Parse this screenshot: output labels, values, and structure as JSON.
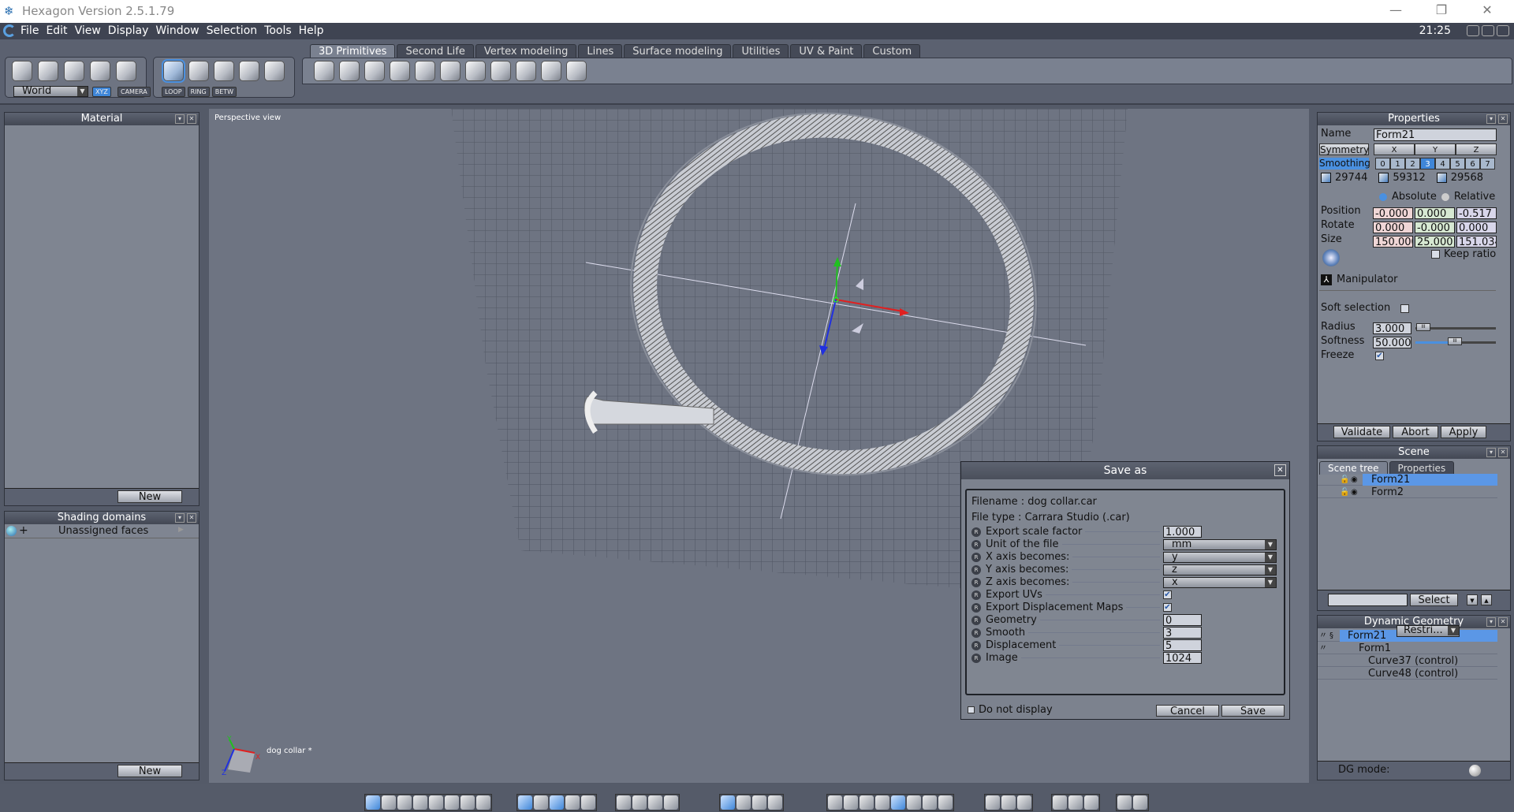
{
  "window": {
    "title": "Hexagon Version 2.5.1.79",
    "minimize": "—",
    "restore": "❐",
    "close": "✕"
  },
  "menu": [
    "File",
    "Edit",
    "View",
    "Display",
    "Window",
    "Selection",
    "Tools",
    "Help"
  ],
  "clock": "21:25",
  "toolbar": {
    "tabs": [
      {
        "label": "3D Primitives",
        "active": true
      },
      {
        "label": "Second Life"
      },
      {
        "label": "Vertex modeling"
      },
      {
        "label": "Lines"
      },
      {
        "label": "Surface modeling"
      },
      {
        "label": "Utilities"
      },
      {
        "label": "UV & Paint"
      },
      {
        "label": "Custom"
      }
    ],
    "manip_icons": [
      "select-arrow-icon",
      "rotate-icon",
      "scale-icon",
      "universal-manipulator-icon",
      "ghost-icon"
    ],
    "coord_space": "World",
    "xyz_label": "XYZ",
    "camera_label": "CAMERA",
    "selection_icons": [
      "object-select-icon",
      "face-select-icon",
      "edge-select-icon",
      "vertex-select-icon",
      "auto-select-icon"
    ],
    "selection_modes": [
      "LOOP",
      "RING",
      "BETW"
    ],
    "primitive_icons": [
      "cube-icon",
      "sphere-icon",
      "plane-icon",
      "grid-plane-icon",
      "cylinder-icon",
      "cone-icon",
      "pyramid-icon",
      "octahedron-icon",
      "dodecahedron-icon",
      "icosahedron-icon",
      "text-3d-icon"
    ]
  },
  "left": {
    "material": {
      "title": "Material",
      "new_label": "New"
    },
    "shading": {
      "title": "Shading domains",
      "item": "Unassigned faces",
      "new_label": "New"
    }
  },
  "viewport": {
    "label": "Perspective view",
    "scene_name": "dog collar *",
    "axes": {
      "x": "X",
      "y": "Y",
      "z": "Z"
    },
    "colors": {
      "x": "#e02020",
      "y": "#20c020",
      "z": "#2030e0"
    }
  },
  "properties": {
    "title": "Properties",
    "name_label": "Name",
    "name_value": "Form21",
    "symmetry_label": "Symmetry",
    "symmetry_axes": [
      "X",
      "Y",
      "Z"
    ],
    "smoothing_label": "Smoothing",
    "smoothing_levels": [
      "0",
      "1",
      "2",
      "3",
      "4",
      "5",
      "6",
      "7"
    ],
    "smoothing_selected": "3",
    "counts": [
      "29744",
      "59312",
      "29568"
    ],
    "absolute": "Absolute",
    "relative": "Relative",
    "mode": "Absolute",
    "position_label": "Position",
    "position": [
      "-0.000",
      "0.000",
      "-0.517"
    ],
    "rotate_label": "Rotate",
    "rotate": [
      "0.000",
      "-0.000",
      "0.000"
    ],
    "size_label": "Size",
    "size": [
      "150.000",
      "25.000",
      "151.034"
    ],
    "keep_ratio": "Keep ratio",
    "keep_ratio_checked": false,
    "manipulator": "Manipulator",
    "soft_selection": "Soft selection",
    "soft_selection_checked": false,
    "radius_label": "Radius",
    "radius": "3.000",
    "softness_label": "Softness",
    "softness": "50.000",
    "freeze_label": "Freeze",
    "freeze_checked": true,
    "validate": "Validate",
    "abort": "Abort",
    "apply": "Apply"
  },
  "scene": {
    "title": "Scene",
    "tabs": [
      "Scene tree",
      "Properties"
    ],
    "items": [
      "Form21",
      "Form2"
    ],
    "select_label": "Select",
    "search_value": ""
  },
  "dyngeo": {
    "title": "Dynamic Geometry",
    "items": [
      "Form21",
      "Form1",
      "Curve37 (control)",
      "Curve48 (control)"
    ],
    "mode_label": "DG mode:",
    "mode_value": "Restri..."
  },
  "dialog": {
    "title": "Save as",
    "filename": "Filename : dog collar.car",
    "filetype": "File type : Carrara Studio  (.car)",
    "rows": [
      {
        "label": "Export scale factor",
        "type": "field",
        "value": "1.000"
      },
      {
        "label": "Unit of the file",
        "type": "select",
        "value": "mm"
      },
      {
        "label": "X axis becomes:",
        "type": "select",
        "value": "y"
      },
      {
        "label": "Y axis becomes:",
        "type": "select",
        "value": "z"
      },
      {
        "label": "Z axis becomes:",
        "type": "select",
        "value": "x"
      },
      {
        "label": "Export UVs",
        "type": "check",
        "value": "✔"
      },
      {
        "label": "Export Displacement Maps",
        "type": "check",
        "value": "✔"
      },
      {
        "label": "Geometry",
        "type": "field",
        "value": "0"
      },
      {
        "label": "Smooth",
        "type": "field",
        "value": "3"
      },
      {
        "label": "Displacement",
        "type": "field",
        "value": "5"
      },
      {
        "label": "Image",
        "type": "field",
        "value": "1024"
      }
    ],
    "reset_glyph": "R",
    "do_not_display": "Do not display",
    "cancel": "Cancel",
    "save": "Save"
  },
  "bottom_groups": [
    [
      "single-view-icon",
      "quad-view-icon",
      "three-view-icon",
      "split-h-icon",
      "split-v-icon",
      "split-3-icon",
      "split-4-icon",
      "split-5-icon"
    ],
    [
      "render-settings-icon",
      "light-icon",
      "grid-icon",
      "grid-fine-icon",
      "grid-snap-icon"
    ],
    [
      "zoom-extents-icon",
      "pan-icon",
      "zoom-icon",
      "orbit-icon"
    ],
    [
      "snap-icon",
      "tools-icon",
      "align-icon",
      "drop-icon"
    ],
    [
      "wireframe-icon",
      "mesh-icon",
      "flat-shade-icon",
      "smooth-shade-icon",
      "textured-icon",
      "lit-icon",
      "matte-icon",
      "gloss-icon"
    ],
    [
      "render-preview-icon",
      "render-icon",
      "material-icon"
    ],
    [
      "box-icon",
      "stack-icon",
      "layout-icon"
    ],
    [
      "settings-icon",
      "camera-icon"
    ]
  ]
}
